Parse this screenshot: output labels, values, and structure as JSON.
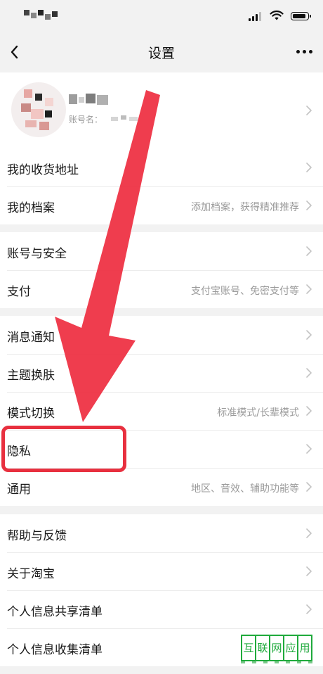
{
  "nav": {
    "title": "设置"
  },
  "profile": {
    "account_label": "账号名："
  },
  "sections": [
    [
      {
        "label": "我的收货地址",
        "value": ""
      },
      {
        "label": "我的档案",
        "value": "添加档案，获得精准推荐"
      }
    ],
    [
      {
        "label": "账号与安全",
        "value": ""
      },
      {
        "label": "支付",
        "value": "支付宝账号、免密支付等"
      }
    ],
    [
      {
        "label": "消息通知",
        "value": ""
      },
      {
        "label": "主题换肤",
        "value": ""
      },
      {
        "label": "模式切换",
        "value": "标准模式/长辈模式"
      },
      {
        "label": "隐私",
        "value": ""
      },
      {
        "label": "通用",
        "value": "地区、音效、辅助功能等"
      }
    ],
    [
      {
        "label": "帮助与反馈",
        "value": ""
      },
      {
        "label": "关于淘宝",
        "value": ""
      },
      {
        "label": "个人信息共享清单",
        "value": ""
      },
      {
        "label": "个人信息收集清单",
        "value": ""
      }
    ]
  ],
  "watermark": {
    "chars": [
      "互",
      "联",
      "网",
      "应",
      "用"
    ]
  },
  "colors": {
    "accent_red": "#e8303f",
    "watermark_green": "#1faa3c"
  }
}
